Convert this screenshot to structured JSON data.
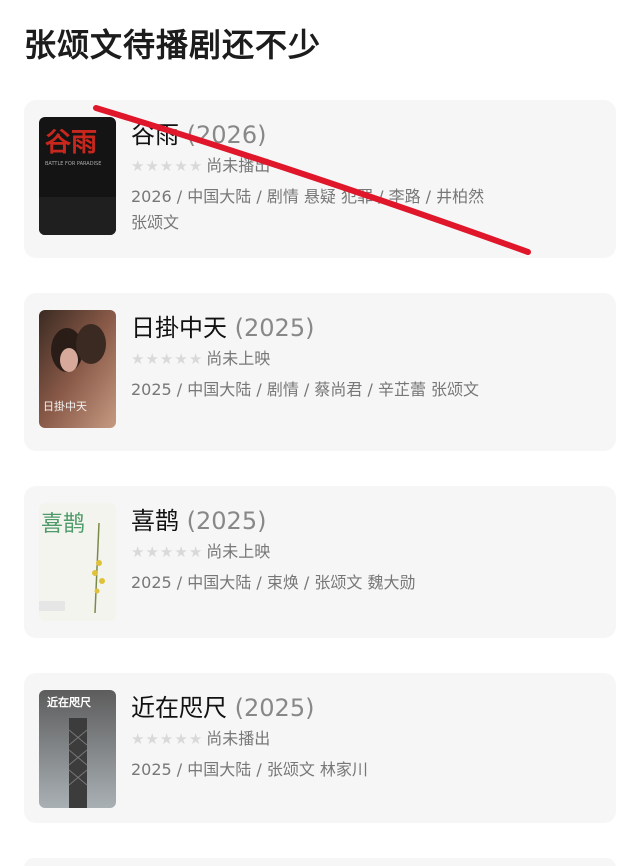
{
  "page_title": "张颂文待播剧还不少",
  "shows": [
    {
      "title": "谷雨",
      "year": "(2026)",
      "rating_text": "尚未播出",
      "meta": "2026 / 中国大陆 / 剧情 悬疑 犯罪 / 李路 / 井柏然 张颂文",
      "poster_text": "谷雨",
      "poster_subtitle": "BATTLE FOR PARADISE"
    },
    {
      "title": "日掛中天",
      "year": "(2025)",
      "rating_text": "尚未上映",
      "meta": "2025 / 中国大陆 / 剧情 / 蔡尚君 / 辛芷蕾 张颂文",
      "poster_text": "日掛中天"
    },
    {
      "title": "喜鹊",
      "year": "(2025)",
      "rating_text": "尚未上映",
      "meta": "2025 / 中国大陆 / 束焕 / 张颂文 魏大勋",
      "poster_text": "喜鹊"
    },
    {
      "title": "近在咫尺",
      "year": "(2025)",
      "rating_text": "尚未播出",
      "meta": "2025 / 中国大陆 / 张颂文 林家川",
      "poster_text": "近在咫尺"
    }
  ],
  "colors": {
    "card_bg": "#f6f6f6",
    "strike_red": "#e0162b",
    "star_empty": "#d9d9d9",
    "muted_text": "#777777"
  }
}
